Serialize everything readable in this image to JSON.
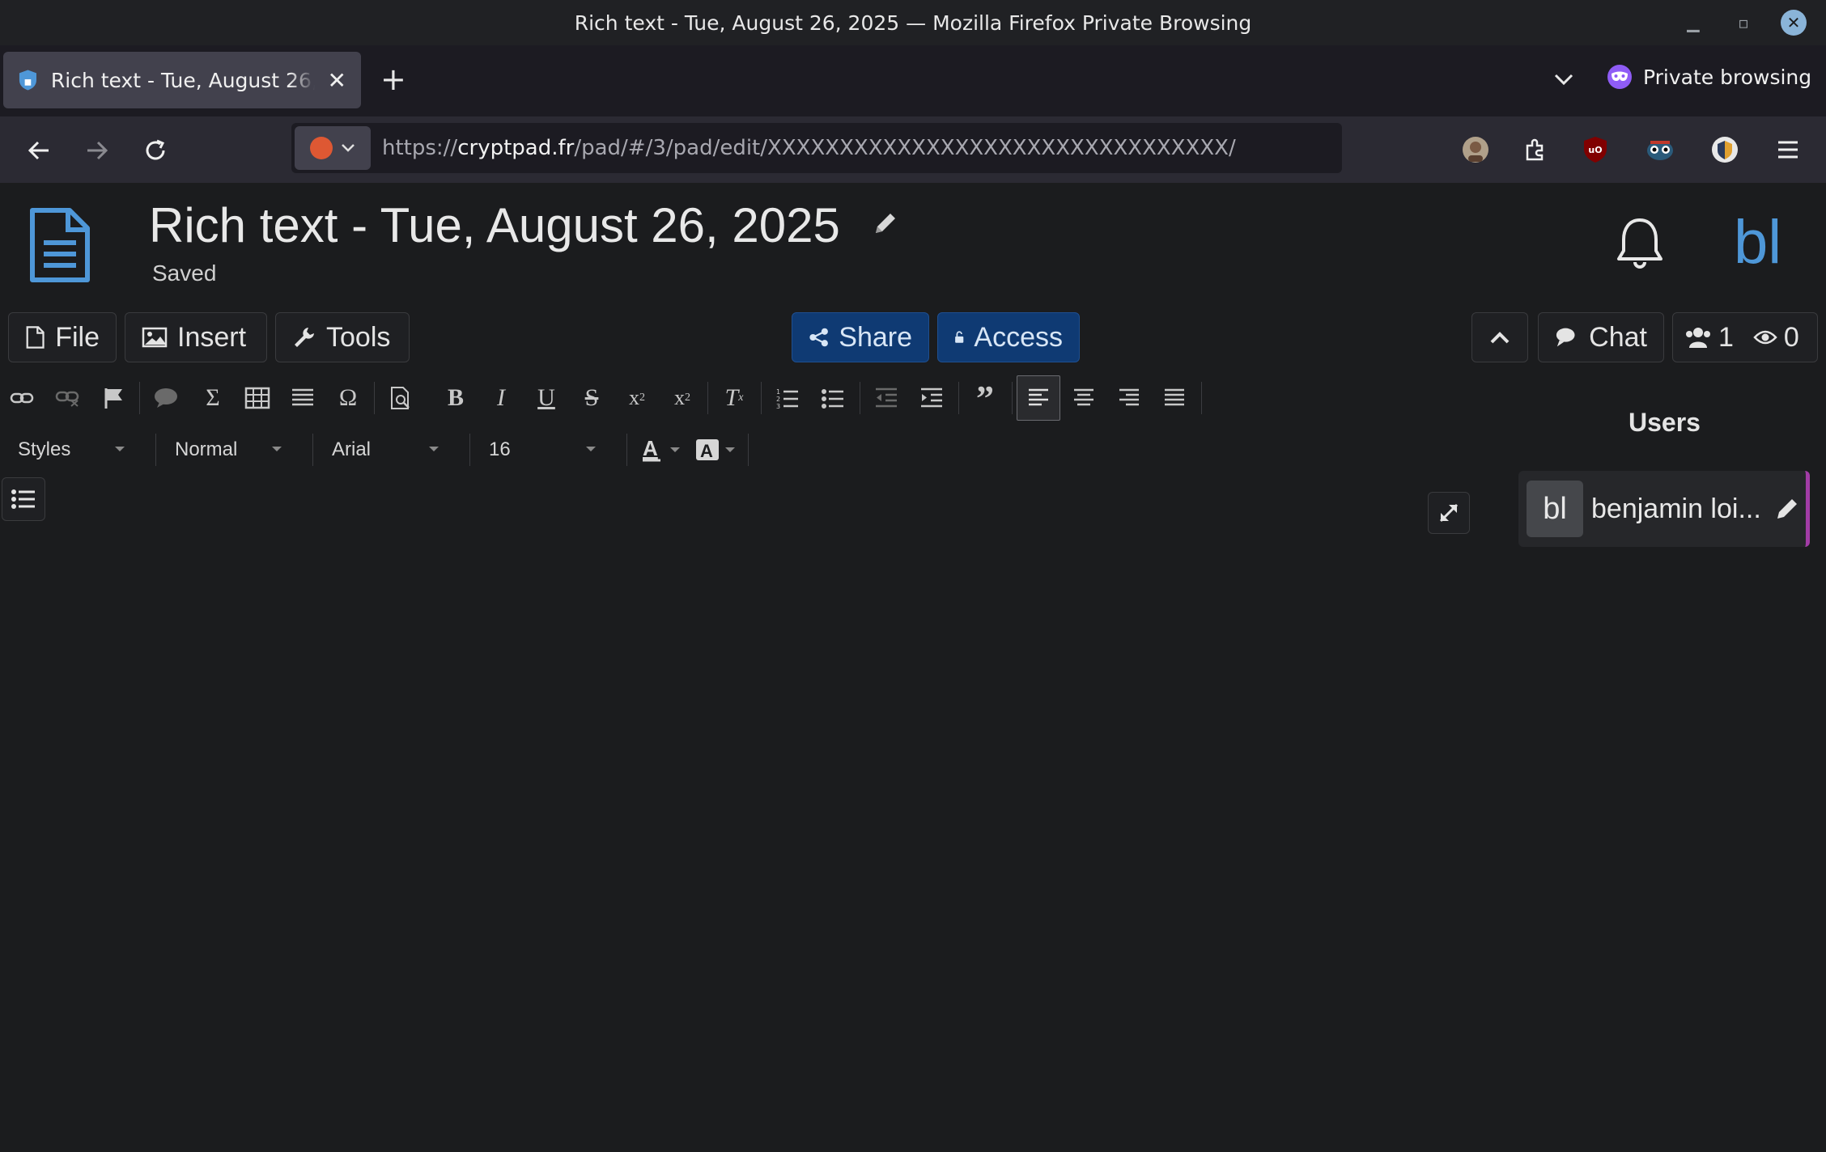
{
  "window": {
    "title": "Rich text - Tue, August 26, 2025 — Mozilla Firefox Private Browsing"
  },
  "tab": {
    "title": "Rich text - Tue, August 26, 2025",
    "close_icon": "close-icon"
  },
  "tabbar": {
    "private_label": "Private browsing"
  },
  "urlbar": {
    "scheme": "https://",
    "host": "cryptpad.fr",
    "path": "/pad/#/3/pad/edit/XXXXXXXXXXXXXXXXXXXXXXXXXXXXXXXX/"
  },
  "doc": {
    "title": "Rich text - Tue, August 26, 2025",
    "status": "Saved"
  },
  "header": {
    "avatar_initials": "bl"
  },
  "menu": {
    "file": "File",
    "insert": "Insert",
    "tools": "Tools",
    "share": "Share",
    "access": "Access",
    "chat": "Chat",
    "users_count": "1",
    "viewers_count": "0"
  },
  "format": {
    "styles": "Styles",
    "paragraph": "Normal",
    "font": "Arial",
    "size": "16"
  },
  "users_panel": {
    "heading": "Users",
    "user_initials": "bl",
    "user_name": "benjamin loi..."
  },
  "colors": {
    "brand_blue": "#4e97d8",
    "share_bg": "#0f3a73",
    "user_accent": "#a23ca6",
    "private_purple": "#8f5cf6"
  }
}
